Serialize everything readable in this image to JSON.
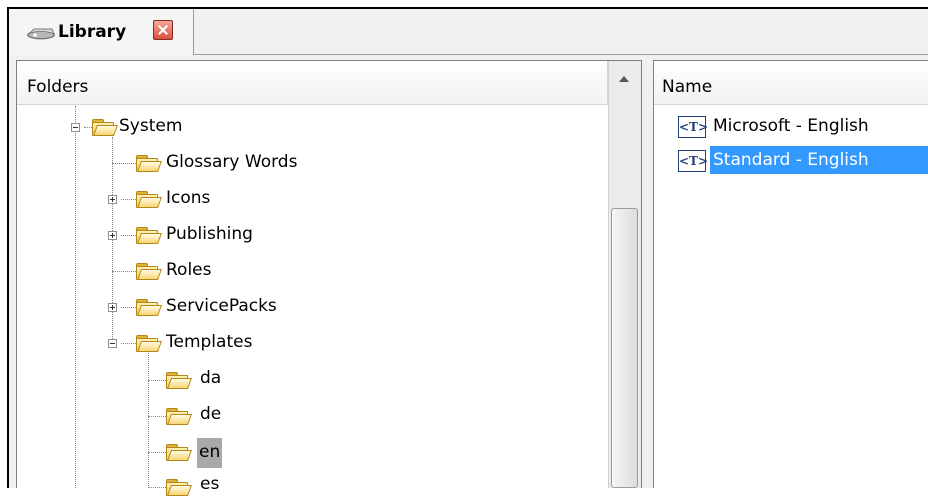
{
  "tab": {
    "title": "Library",
    "close_icon": "close-icon"
  },
  "left_panel": {
    "header": "Folders",
    "tree": [
      {
        "label": "System",
        "level": 0,
        "expander": "minus"
      },
      {
        "label": "Glossary Words",
        "level": 1,
        "expander": "none"
      },
      {
        "label": "Icons",
        "level": 1,
        "expander": "plus"
      },
      {
        "label": "Publishing",
        "level": 1,
        "expander": "plus"
      },
      {
        "label": "Roles",
        "level": 1,
        "expander": "none"
      },
      {
        "label": "ServicePacks",
        "level": 1,
        "expander": "plus"
      },
      {
        "label": "Templates",
        "level": 1,
        "expander": "minus"
      },
      {
        "label": "da",
        "level": 2,
        "expander": "none"
      },
      {
        "label": "de",
        "level": 2,
        "expander": "none"
      },
      {
        "label": "en",
        "level": 2,
        "expander": "none",
        "selected": true
      },
      {
        "label": "es",
        "level": 2,
        "expander": "none"
      }
    ]
  },
  "right_panel": {
    "header": "Name",
    "items": [
      {
        "label": "Microsoft - English",
        "icon": "template-icon",
        "selected": false
      },
      {
        "label": "Standard - English",
        "icon": "template-icon",
        "selected": true
      }
    ]
  },
  "colors": {
    "selection": "#3399ff",
    "inactive_selection": "#a9a9a9",
    "folder": "#f1c84d",
    "close_button": "#d9533f"
  }
}
